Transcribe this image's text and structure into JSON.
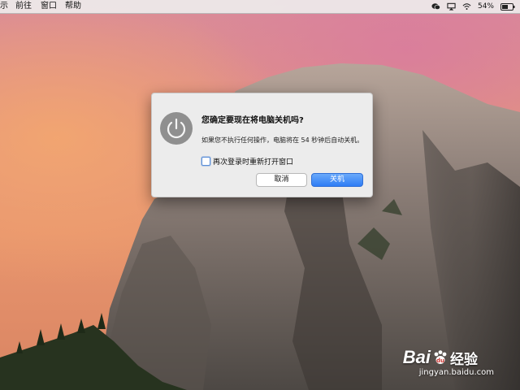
{
  "menubar": {
    "items": [
      "示",
      "前往",
      "窗口",
      "帮助"
    ],
    "battery": "54%",
    "icons": [
      "wechat-icon",
      "screen-mirroring-icon",
      "wifi-icon",
      "battery-icon"
    ]
  },
  "dialog": {
    "icon": "power-icon",
    "title": "您确定要现在将电脑关机吗?",
    "message": "如果您不执行任何操作，电脑将在 54 秒钟后自动关机。",
    "checkbox_label": "再次登录时重新打开窗口",
    "checkbox_checked": false,
    "cancel_label": "取消",
    "shutdown_label": "关机",
    "accent_color": "#2e7cf5"
  },
  "watermark": {
    "brand": "Bai",
    "product": "经验",
    "url": "jingyan.baidu.com"
  }
}
